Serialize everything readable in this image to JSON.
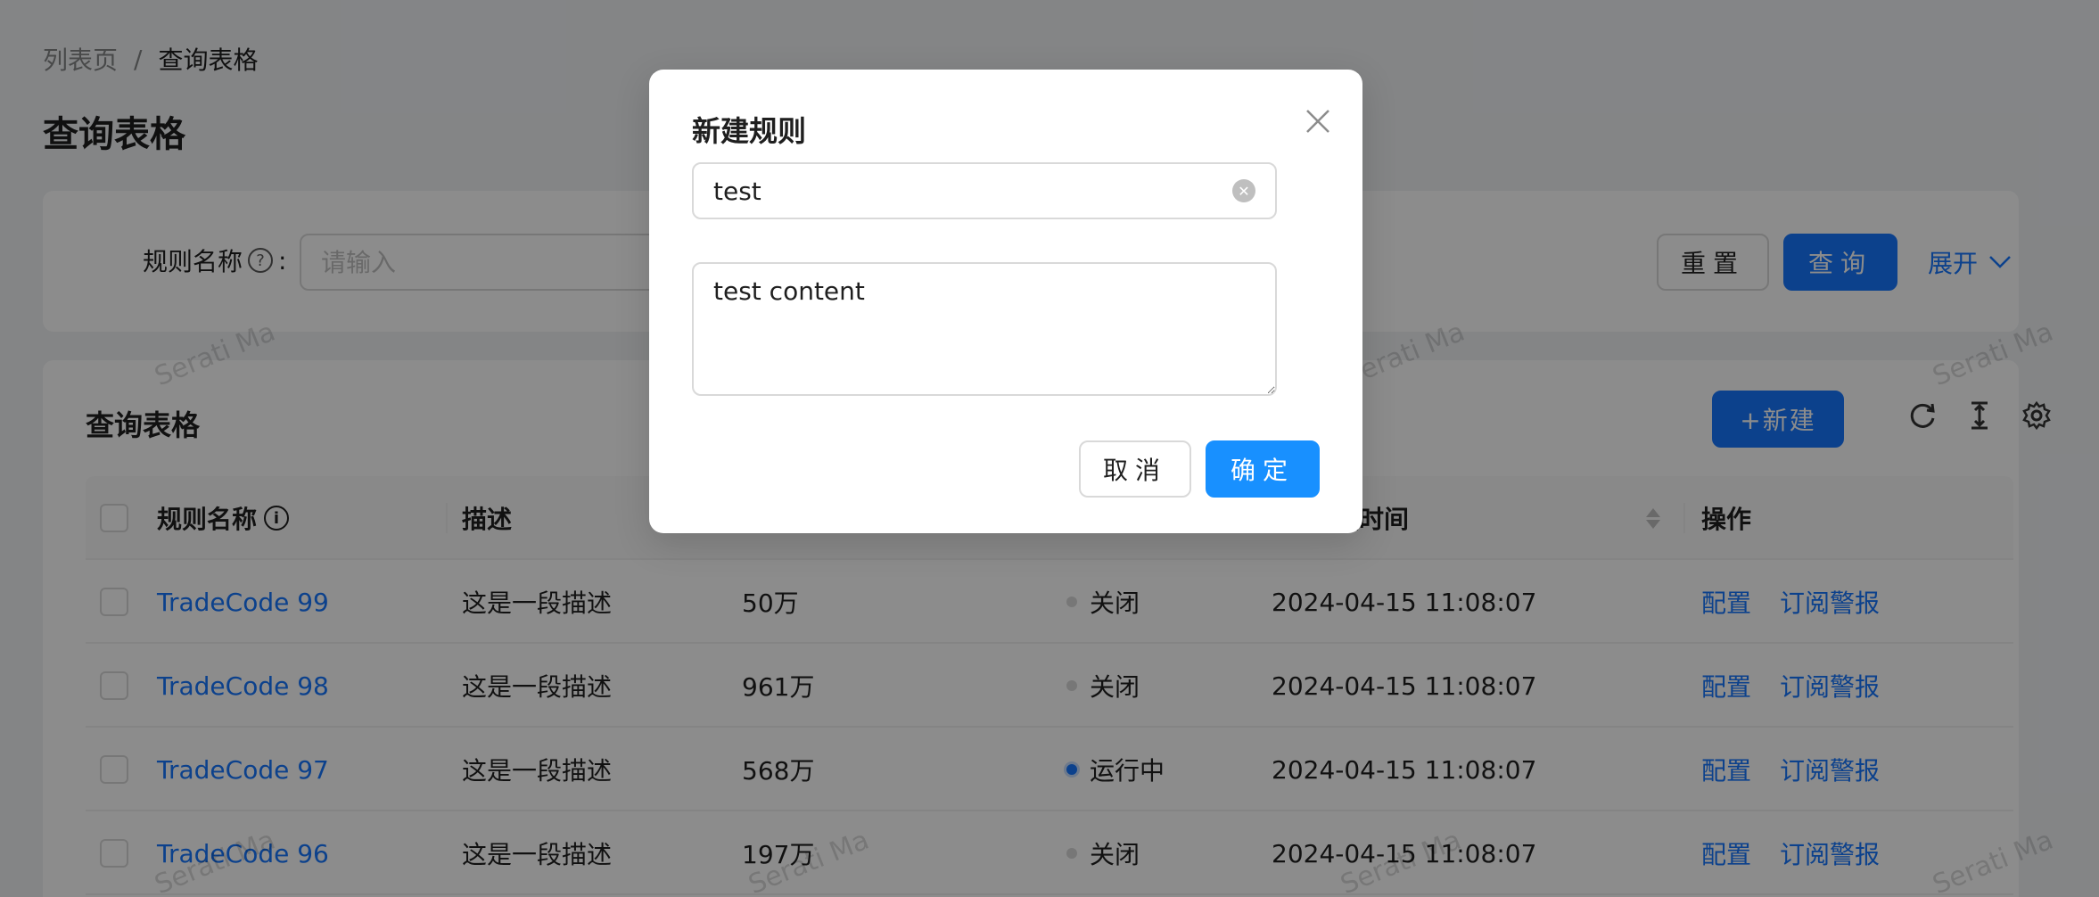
{
  "breadcrumb": {
    "parent": "列表页",
    "separator": "/",
    "current": "查询表格"
  },
  "page_title": "查询表格",
  "search": {
    "rule_name_label": "规则名称",
    "colon": ":",
    "placeholder": "请输入",
    "reset_label": "重置",
    "query_label": "查询",
    "expand_label": "展开"
  },
  "table_card": {
    "title": "查询表格",
    "new_label": "+新建",
    "columns": {
      "rule_name": "规则名称",
      "desc": "描述",
      "time": "更时间",
      "action": "操作"
    },
    "rows": [
      {
        "name": "TradeCode 99",
        "desc": "这是一段描述",
        "count": "50万",
        "status": "关闭",
        "status_type": "default",
        "time": "2024-04-15 11:08:07",
        "op_config": "配置",
        "op_subscribe": "订阅警报"
      },
      {
        "name": "TradeCode 98",
        "desc": "这是一段描述",
        "count": "961万",
        "status": "关闭",
        "status_type": "default",
        "time": "2024-04-15 11:08:07",
        "op_config": "配置",
        "op_subscribe": "订阅警报"
      },
      {
        "name": "TradeCode 97",
        "desc": "这是一段描述",
        "count": "568万",
        "status": "运行中",
        "status_type": "processing",
        "time": "2024-04-15 11:08:07",
        "op_config": "配置",
        "op_subscribe": "订阅警报"
      },
      {
        "name": "TradeCode 96",
        "desc": "这是一段描述",
        "count": "197万",
        "status": "关闭",
        "status_type": "default",
        "time": "2024-04-15 11:08:07",
        "op_config": "配置",
        "op_subscribe": "订阅警报"
      }
    ]
  },
  "watermark_text": "Serati Ma",
  "modal": {
    "title": "新建规则",
    "name_value": "test",
    "content_value": "test content",
    "cancel_label": "取消",
    "ok_label": "确定"
  },
  "icons": {
    "close": "close-icon",
    "clear": "close-circle-icon",
    "reload": "reload-icon",
    "density": "column-height-icon",
    "settings": "setting-icon",
    "help": "question-circle-icon",
    "info": "info-circle-icon",
    "expand": "chevron-down-icon"
  },
  "colors": {
    "primary": "#1677ff",
    "mask": "rgba(0,0,0,0.45)",
    "status_default": "#d9d9d9"
  }
}
